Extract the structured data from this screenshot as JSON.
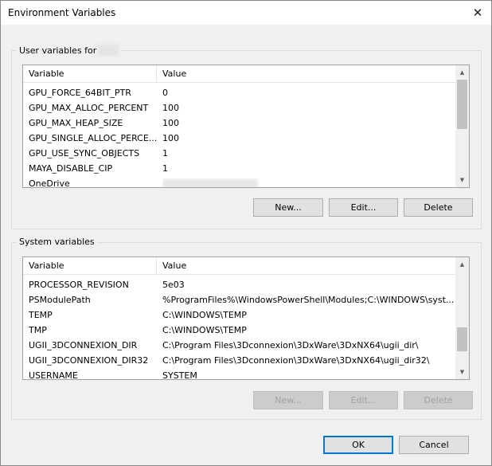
{
  "window": {
    "title": "Environment Variables",
    "close_glyph": "✕"
  },
  "user_group": {
    "label": "User variables for",
    "header": {
      "variable": "Variable",
      "value": "Value"
    },
    "rows": [
      {
        "variable": "GPU_FORCE_64BIT_PTR",
        "value": "0"
      },
      {
        "variable": "GPU_MAX_ALLOC_PERCENT",
        "value": "100"
      },
      {
        "variable": "GPU_MAX_HEAP_SIZE",
        "value": "100"
      },
      {
        "variable": "GPU_SINGLE_ALLOC_PERCE...",
        "value": "100"
      },
      {
        "variable": "GPU_USE_SYNC_OBJECTS",
        "value": "1"
      },
      {
        "variable": "MAYA_DISABLE_CIP",
        "value": "1"
      },
      {
        "variable": "OneDrive",
        "value": ""
      }
    ],
    "buttons": {
      "new": "New...",
      "edit": "Edit...",
      "delete": "Delete"
    }
  },
  "system_group": {
    "label": "System variables",
    "header": {
      "variable": "Variable",
      "value": "Value"
    },
    "rows": [
      {
        "variable": "PROCESSOR_REVISION",
        "value": "5e03"
      },
      {
        "variable": "PSModulePath",
        "value": "%ProgramFiles%\\WindowsPowerShell\\Modules;C:\\WINDOWS\\syst..."
      },
      {
        "variable": "TEMP",
        "value": "C:\\WINDOWS\\TEMP"
      },
      {
        "variable": "TMP",
        "value": "C:\\WINDOWS\\TEMP"
      },
      {
        "variable": "UGII_3DCONNEXION_DIR",
        "value": "C:\\Program Files\\3Dconnexion\\3DxWare\\3DxNX64\\ugii_dir\\"
      },
      {
        "variable": "UGII_3DCONNEXION_DIR32",
        "value": "C:\\Program Files\\3Dconnexion\\3DxWare\\3DxNX64\\ugii_dir32\\"
      },
      {
        "variable": "USERNAME",
        "value": "SYSTEM"
      }
    ],
    "buttons": {
      "new": "New...",
      "edit": "Edit...",
      "delete": "Delete"
    }
  },
  "footer": {
    "ok": "OK",
    "cancel": "Cancel"
  },
  "icons": {
    "scroll_up": "chevron-up-icon",
    "scroll_down": "chevron-down-icon",
    "close": "close-icon"
  }
}
